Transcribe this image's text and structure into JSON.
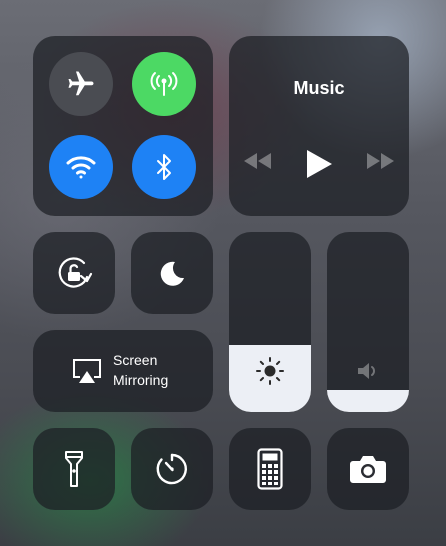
{
  "connectivity": {
    "airplane": {
      "icon": "airplane-icon",
      "active": false,
      "color": "#4a4c52"
    },
    "cellular": {
      "icon": "antenna-icon",
      "active": true,
      "color": "#4cd964"
    },
    "wifi": {
      "icon": "wifi-icon",
      "active": true,
      "color": "#1e82f5"
    },
    "bluetooth": {
      "icon": "bluetooth-icon",
      "active": true,
      "color": "#1e82f5"
    }
  },
  "music": {
    "title": "Music",
    "controls": [
      "rewind-icon",
      "play-icon",
      "fast-forward-icon"
    ]
  },
  "screen_mirroring": {
    "line1": "Screen",
    "line2": "Mirroring",
    "icon": "airplay-icon"
  },
  "brightness": {
    "level": 0.37,
    "icon": "sun-icon"
  },
  "volume": {
    "level": 0.12,
    "icon": "speaker-icon"
  },
  "toggles": [
    "rotation-lock-icon",
    "moon-icon"
  ],
  "shortcuts": [
    "flashlight-icon",
    "timer-icon",
    "calculator-icon",
    "camera-icon"
  ]
}
